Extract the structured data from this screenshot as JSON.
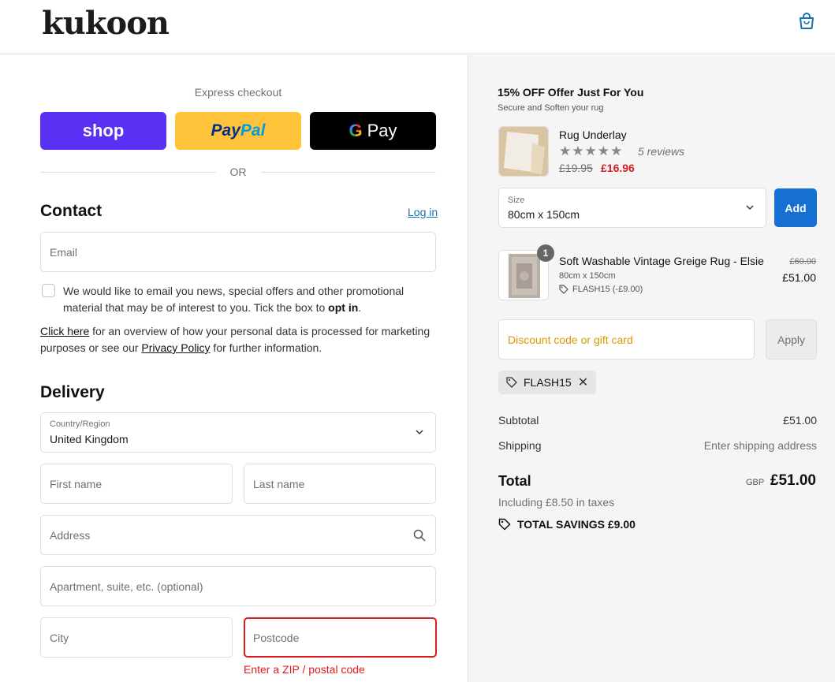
{
  "header": {
    "logo": "kukoon",
    "cart_icon": "shopping-bag-icon"
  },
  "express": {
    "label": "Express checkout",
    "shop_label": "shop",
    "paypal_label_1": "Pay",
    "paypal_label_2": "Pal",
    "gpay_g": "G",
    "gpay_label": "Pay",
    "or": "OR"
  },
  "contact": {
    "title": "Contact",
    "login": "Log in",
    "email_placeholder": "Email",
    "consent_text": "We would like to email you news, special offers and other promotional material that may be of interest to you. Tick the box to ",
    "consent_bold": "opt in",
    "consent_end": ".",
    "privacy_link1": "Click here",
    "privacy_text1": " for an overview of how your personal data is processed for marketing purposes or see our ",
    "privacy_link2": "Privacy Policy",
    "privacy_text2": " for further information."
  },
  "delivery": {
    "title": "Delivery",
    "country_label": "Country/Region",
    "country_value": "United Kingdom",
    "first_name": "First name",
    "last_name": "Last name",
    "address": "Address",
    "apartment": "Apartment, suite, etc. (optional)",
    "city": "City",
    "postcode": "Postcode",
    "postcode_error": "Enter a ZIP / postal code"
  },
  "offer": {
    "title": "15% OFF Offer Just For You",
    "subtitle": "Secure and Soften your rug",
    "product_name": "Rug Underlay",
    "stars": "★★★★★",
    "reviews": "5 reviews",
    "old_price": "£19.95",
    "new_price": "£16.96",
    "size_label": "Size",
    "size_value": "80cm x 150cm",
    "add": "Add"
  },
  "cart_item": {
    "qty": "1",
    "name": "Soft Washable Vintage Greige Rug - Elsie",
    "variant": "80cm x 150cm",
    "discount": "FLASH15 (-£9.00)",
    "old_price": "£60.00",
    "price": "£51.00"
  },
  "discount": {
    "placeholder": "Discount code or gift card",
    "apply": "Apply",
    "applied_code": "FLASH15",
    "remove": "✕"
  },
  "summary": {
    "subtotal_label": "Subtotal",
    "subtotal_value": "£51.00",
    "shipping_label": "Shipping",
    "shipping_value": "Enter shipping address",
    "total_label": "Total",
    "currency": "GBP",
    "total_value": "£51.00",
    "taxes": "Including £8.50 in taxes",
    "savings": "TOTAL SAVINGS  £9.00"
  },
  "colors": {
    "shop": "#5a31f4",
    "paypal": "#ffc439",
    "add_button": "#1670d1",
    "error": "#dd1d1d",
    "sale_price": "#d0212b"
  }
}
